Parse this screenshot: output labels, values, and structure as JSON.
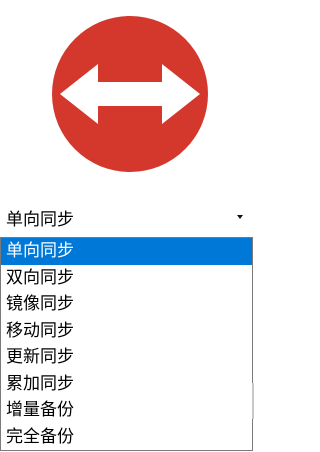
{
  "colors": {
    "logo_circle": "#d4382c",
    "logo_arrow": "#ffffff",
    "selection_highlight": "#0078d7"
  },
  "logo": {
    "icon": "double-arrow-icon"
  },
  "sync_mode_select": {
    "value": "单向同步",
    "options": [
      {
        "label": "单向同步",
        "selected": true
      },
      {
        "label": "双向同步",
        "selected": false
      },
      {
        "label": "镜像同步",
        "selected": false
      },
      {
        "label": "移动同步",
        "selected": false
      },
      {
        "label": "更新同步",
        "selected": false
      },
      {
        "label": "累加同步",
        "selected": false
      },
      {
        "label": "增量备份",
        "selected": false
      },
      {
        "label": "完全备份",
        "selected": false
      }
    ]
  }
}
